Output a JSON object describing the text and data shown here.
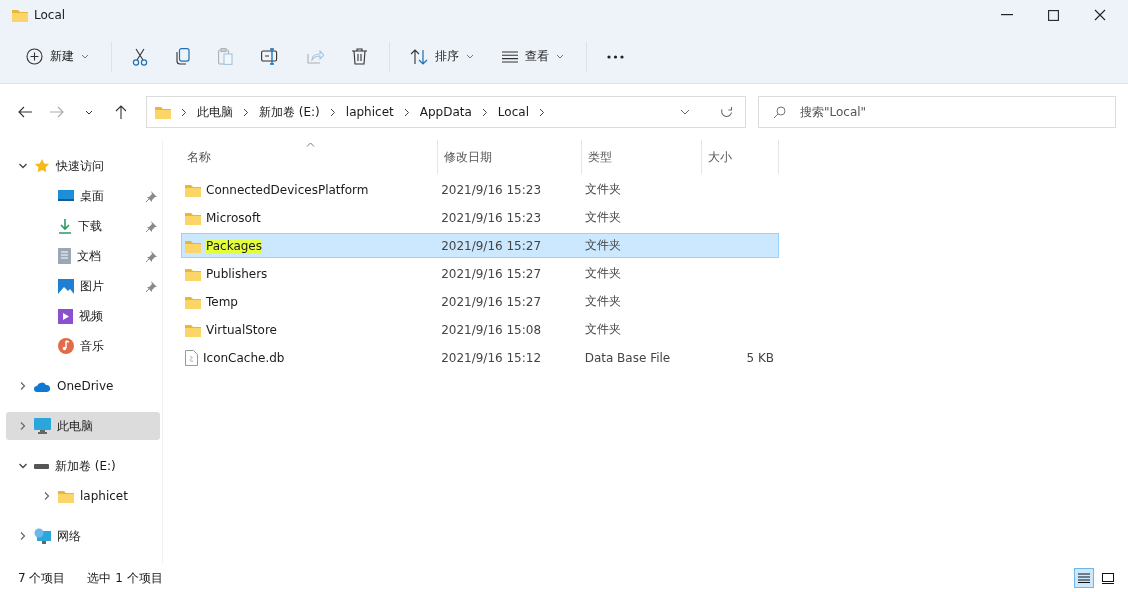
{
  "window": {
    "title": "Local"
  },
  "toolbar": [
    {
      "kind": "new",
      "label": "新建",
      "disabled": false
    },
    {
      "kind": "separator"
    },
    {
      "kind": "cut",
      "disabled": false
    },
    {
      "kind": "copy",
      "disabled": false
    },
    {
      "kind": "paste",
      "disabled": true
    },
    {
      "kind": "rename",
      "disabled": false
    },
    {
      "kind": "share",
      "disabled": true
    },
    {
      "kind": "delete",
      "disabled": false
    },
    {
      "kind": "separator"
    },
    {
      "kind": "sort",
      "label": "排序",
      "disabled": false
    },
    {
      "kind": "view",
      "label": "查看",
      "disabled": false
    },
    {
      "kind": "separator"
    },
    {
      "kind": "more",
      "disabled": false
    }
  ],
  "navigation": [
    {
      "kind": "back",
      "disabled": false
    },
    {
      "kind": "forward",
      "disabled": true
    },
    {
      "kind": "recent",
      "disabled": false
    },
    {
      "kind": "up",
      "disabled": false
    }
  ],
  "address_bar": {
    "segments": [
      "此电脑",
      "新加卷 (E:)",
      "laphicet",
      "AppData",
      "Local"
    ]
  },
  "search": {
    "placeholder": "搜索\"Local\""
  },
  "sidebar": {
    "items": [
      {
        "label": "快速访问",
        "kind": "quick-access",
        "expanded": true,
        "selected": false,
        "children": [
          {
            "label": "桌面",
            "kind": "desktop",
            "pinned": true,
            "selected": false
          },
          {
            "label": "下载",
            "kind": "downloads",
            "pinned": true,
            "selected": false
          },
          {
            "label": "文档",
            "kind": "documents",
            "pinned": true,
            "selected": false
          },
          {
            "label": "图片",
            "kind": "pictures",
            "pinned": true,
            "selected": false
          },
          {
            "label": "视频",
            "kind": "videos",
            "pinned": false,
            "selected": false
          },
          {
            "label": "音乐",
            "kind": "music",
            "pinned": false,
            "selected": false
          }
        ]
      },
      {
        "label": "OneDrive",
        "kind": "cloud",
        "expanded": false,
        "selected": false
      },
      {
        "label": "此电脑",
        "kind": "computer",
        "expanded": false,
        "selected": true
      },
      {
        "label": "新加卷 (E:)",
        "kind": "drive",
        "expanded": true,
        "selected": false,
        "children": [
          {
            "label": "laphicet",
            "kind": "folder",
            "expanded": false,
            "selected": false
          }
        ]
      },
      {
        "label": "网络",
        "kind": "network",
        "expanded": false,
        "selected": false
      }
    ]
  },
  "table": {
    "columns": [
      {
        "label": "名称",
        "sorted": true
      },
      {
        "label": "修改日期",
        "sorted": false
      },
      {
        "label": "类型",
        "sorted": false
      },
      {
        "label": "大小",
        "sorted": false
      }
    ],
    "rows": [
      {
        "kind": "folder",
        "name": "ConnectedDevicesPlatform",
        "date": "2021/9/16 15:23",
        "type": "文件夹",
        "selected": false,
        "highlighted": false
      },
      {
        "kind": "folder",
        "name": "Microsoft",
        "date": "2021/9/16 15:23",
        "type": "文件夹",
        "selected": false,
        "highlighted": false
      },
      {
        "kind": "folder",
        "name": "Packages",
        "date": "2021/9/16 15:27",
        "type": "文件夹",
        "selected": true,
        "highlighted": true
      },
      {
        "kind": "folder",
        "name": "Publishers",
        "date": "2021/9/16 15:27",
        "type": "文件夹",
        "selected": false,
        "highlighted": false
      },
      {
        "kind": "folder",
        "name": "Temp",
        "date": "2021/9/16 15:27",
        "type": "文件夹",
        "selected": false,
        "highlighted": false
      },
      {
        "kind": "folder",
        "name": "VirtualStore",
        "date": "2021/9/16 15:08",
        "type": "文件夹",
        "selected": false,
        "highlighted": false
      },
      {
        "kind": "file",
        "name": "IconCache.db",
        "date": "2021/9/16 15:12",
        "type": "Data Base File",
        "size": "5 KB",
        "selected": false,
        "highlighted": false
      }
    ]
  },
  "status_bar": {
    "item_count": "7 个项目",
    "selection": "选中 1 个项目",
    "view_buttons": [
      {
        "kind": "details",
        "selected": true
      },
      {
        "kind": "tiles",
        "selected": false
      }
    ]
  }
}
